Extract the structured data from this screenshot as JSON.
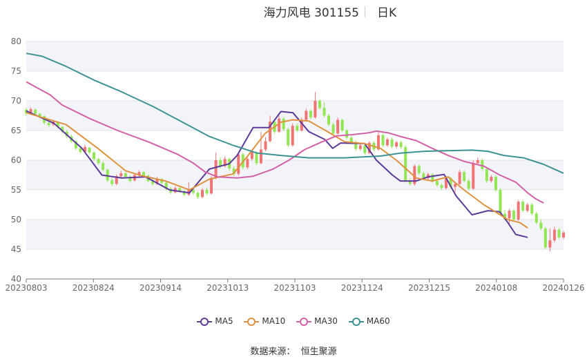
{
  "header": {
    "title": "海力风电 301155",
    "period": "日K"
  },
  "source": {
    "label": "数据来源：",
    "value": "恒生聚源"
  },
  "colors": {
    "up": "#f07474",
    "down": "#92e553",
    "ma5": "#5b3a9a",
    "ma10": "#e0913e",
    "ma30": "#d35fa6",
    "ma60": "#3c9292",
    "band": "#f3f4fa",
    "grid": "#e3e3ea"
  },
  "chart_data": {
    "type": "candlestick",
    "y_axis": {
      "min": 40,
      "max": 80,
      "ticks": [
        40,
        45,
        50,
        55,
        60,
        65,
        70,
        75,
        80
      ]
    },
    "x_axis": {
      "ticks": [
        "20230803",
        "20230824",
        "20230914",
        "20231013",
        "20231103",
        "20231124",
        "20231215",
        "20240108",
        "20240126"
      ]
    },
    "legend": [
      "MA5",
      "MA10",
      "MA30",
      "MA60"
    ],
    "grid": true,
    "candles": [
      [
        68.5,
        67.9,
        68.8,
        67.5
      ],
      [
        67.9,
        68.6,
        68.9,
        67.6
      ],
      [
        68.5,
        67.8,
        68.7,
        67.5
      ],
      [
        67.8,
        67.4,
        68.0,
        67.1
      ],
      [
        67.4,
        66.3,
        67.6,
        66.0
      ],
      [
        66.3,
        65.9,
        66.6,
        65.5
      ],
      [
        66.0,
        66.5,
        66.8,
        65.7
      ],
      [
        66.4,
        65.6,
        66.6,
        65.3
      ],
      [
        65.6,
        64.8,
        65.8,
        64.5
      ],
      [
        64.8,
        64.0,
        65.1,
        63.7
      ],
      [
        64.0,
        63.2,
        64.3,
        62.9
      ],
      [
        63.2,
        62.0,
        63.4,
        61.7
      ],
      [
        62.0,
        61.4,
        62.3,
        61.1
      ],
      [
        61.4,
        62.2,
        62.6,
        61.2
      ],
      [
        62.1,
        61.3,
        62.3,
        61.0
      ],
      [
        61.3,
        60.2,
        61.5,
        59.9
      ],
      [
        60.2,
        59.5,
        60.4,
        59.2
      ],
      [
        59.5,
        58.4,
        59.8,
        58.1
      ],
      [
        58.4,
        56.6,
        58.6,
        56.3
      ],
      [
        56.6,
        56.0,
        57.0,
        55.6
      ],
      [
        56.0,
        57.3,
        57.6,
        55.8
      ],
      [
        57.3,
        57.8,
        58.2,
        57.0
      ],
      [
        57.8,
        57.2,
        58.0,
        56.9
      ],
      [
        57.2,
        56.5,
        57.5,
        56.2
      ],
      [
        56.6,
        57.5,
        57.8,
        56.4
      ],
      [
        57.5,
        58.0,
        58.3,
        57.2
      ],
      [
        58.0,
        57.4,
        58.2,
        57.1
      ],
      [
        57.4,
        56.5,
        57.6,
        56.2
      ],
      [
        56.5,
        56.0,
        56.8,
        55.7
      ],
      [
        56.0,
        56.8,
        57.2,
        55.8
      ],
      [
        56.8,
        56.2,
        57.0,
        55.9
      ],
      [
        56.2,
        55.2,
        56.4,
        54.9
      ],
      [
        55.2,
        54.6,
        55.5,
        54.3
      ],
      [
        54.6,
        55.3,
        55.6,
        54.4
      ],
      [
        55.3,
        54.8,
        55.5,
        54.5
      ],
      [
        54.8,
        54.2,
        55.0,
        53.9
      ],
      [
        54.2,
        55.0,
        56.3,
        54.0
      ],
      [
        55.0,
        54.5,
        55.4,
        54.2
      ],
      [
        54.5,
        53.8,
        54.8,
        53.5
      ],
      [
        53.8,
        55.0,
        55.3,
        53.6
      ],
      [
        55.0,
        54.4,
        55.4,
        54.1
      ],
      [
        54.4,
        57.0,
        57.3,
        54.2
      ],
      [
        57.0,
        60.0,
        61.3,
        56.8
      ],
      [
        60.0,
        59.0,
        60.5,
        58.6
      ],
      [
        59.0,
        60.2,
        60.6,
        58.8
      ],
      [
        60.2,
        58.6,
        60.4,
        58.2
      ],
      [
        58.6,
        57.7,
        59.0,
        57.3
      ],
      [
        57.7,
        61.0,
        61.3,
        57.4
      ],
      [
        61.0,
        58.8,
        61.2,
        58.4
      ],
      [
        58.8,
        60.2,
        60.5,
        58.5
      ],
      [
        60.2,
        61.3,
        61.8,
        59.9
      ],
      [
        61.3,
        59.5,
        61.5,
        59.2
      ],
      [
        59.5,
        61.8,
        64.8,
        59.3
      ],
      [
        61.8,
        63.2,
        63.9,
        61.5
      ],
      [
        63.2,
        66.5,
        67.5,
        63.0
      ],
      [
        66.5,
        64.8,
        66.9,
        64.5
      ],
      [
        64.8,
        67.0,
        67.5,
        64.6
      ],
      [
        67.0,
        65.2,
        67.3,
        64.9
      ],
      [
        65.2,
        62.5,
        65.5,
        62.2
      ],
      [
        62.5,
        65.8,
        66.2,
        62.3
      ],
      [
        65.8,
        65.0,
        66.2,
        64.7
      ],
      [
        65.0,
        66.8,
        67.2,
        64.8
      ],
      [
        66.8,
        68.3,
        68.7,
        66.5
      ],
      [
        68.3,
        67.2,
        68.6,
        66.9
      ],
      [
        67.2,
        70.0,
        71.5,
        67.0
      ],
      [
        70.0,
        68.8,
        70.3,
        68.5
      ],
      [
        68.8,
        67.5,
        69.8,
        67.2
      ],
      [
        67.5,
        66.0,
        67.8,
        65.7
      ],
      [
        66.0,
        64.5,
        66.3,
        64.2
      ],
      [
        64.5,
        66.8,
        67.2,
        64.3
      ],
      [
        66.8,
        65.0,
        67.0,
        64.7
      ],
      [
        65.0,
        63.8,
        65.3,
        63.5
      ],
      [
        63.8,
        63.0,
        64.1,
        62.7
      ],
      [
        63.0,
        61.9,
        63.3,
        61.6
      ],
      [
        61.9,
        62.5,
        62.8,
        61.6
      ],
      [
        62.5,
        61.2,
        62.7,
        60.9
      ],
      [
        61.2,
        62.9,
        63.2,
        61.0
      ],
      [
        62.9,
        61.8,
        63.2,
        61.5
      ],
      [
        61.8,
        64.2,
        64.8,
        61.6
      ],
      [
        64.2,
        62.5,
        64.5,
        62.2
      ],
      [
        62.5,
        63.5,
        63.8,
        62.2
      ],
      [
        63.5,
        62.3,
        63.8,
        62.0
      ],
      [
        62.3,
        63.0,
        63.3,
        62.0
      ],
      [
        63.0,
        62.2,
        63.3,
        61.9
      ],
      [
        62.2,
        56.5,
        62.5,
        56.2
      ],
      [
        56.5,
        56.0,
        57.0,
        55.7
      ],
      [
        56.0,
        59.0,
        59.3,
        55.7
      ],
      [
        59.0,
        57.8,
        59.3,
        57.5
      ],
      [
        57.8,
        57.0,
        58.1,
        56.7
      ],
      [
        57.0,
        57.6,
        57.9,
        56.7
      ],
      [
        57.6,
        56.5,
        57.8,
        56.2
      ],
      [
        56.5,
        55.8,
        56.8,
        55.5
      ],
      [
        55.8,
        55.3,
        56.1,
        55.0
      ],
      [
        55.3,
        57.0,
        57.3,
        55.1
      ],
      [
        57.0,
        55.5,
        57.2,
        55.2
      ],
      [
        55.5,
        56.0,
        56.3,
        54.6
      ],
      [
        56.0,
        58.0,
        58.4,
        55.8
      ],
      [
        58.0,
        56.5,
        58.3,
        56.2
      ],
      [
        56.5,
        55.2,
        56.8,
        54.9
      ],
      [
        55.2,
        59.5,
        60.0,
        55.0
      ],
      [
        59.5,
        60.0,
        60.5,
        59.2
      ],
      [
        60.0,
        58.5,
        60.3,
        58.2
      ],
      [
        58.5,
        56.5,
        58.8,
        56.2
      ],
      [
        56.5,
        57.2,
        57.5,
        56.2
      ],
      [
        57.2,
        55.0,
        57.5,
        54.7
      ],
      [
        55.0,
        51.0,
        55.3,
        50.7
      ],
      [
        51.0,
        50.2,
        51.6,
        49.9
      ],
      [
        50.2,
        51.5,
        51.8,
        49.0
      ],
      [
        51.5,
        50.0,
        51.8,
        49.7
      ],
      [
        50.0,
        53.0,
        53.3,
        49.8
      ],
      [
        53.0,
        51.5,
        53.3,
        51.2
      ],
      [
        51.5,
        52.5,
        52.8,
        51.2
      ],
      [
        52.5,
        51.0,
        52.8,
        50.7
      ],
      [
        51.0,
        49.5,
        51.3,
        49.2
      ],
      [
        49.5,
        48.5,
        50.0,
        48.2
      ],
      [
        48.5,
        45.3,
        48.8,
        45.0
      ],
      [
        45.3,
        46.5,
        48.5,
        44.6
      ],
      [
        46.5,
        48.3,
        48.8,
        46.2
      ],
      [
        48.3,
        47.0,
        48.6,
        46.7
      ],
      [
        47.0,
        47.8,
        48.1,
        46.7
      ]
    ],
    "series": [
      {
        "name": "MA5",
        "values": [
          [
            0,
            68.3
          ],
          [
            7,
            66.2
          ],
          [
            14,
            62.0
          ],
          [
            19,
            57.5
          ],
          [
            24,
            57.0
          ],
          [
            30,
            57.2
          ],
          [
            36,
            55.0
          ],
          [
            41,
            54.5
          ],
          [
            46,
            58.5
          ],
          [
            51,
            59.4
          ],
          [
            53,
            60.8
          ],
          [
            57,
            65.5
          ],
          [
            61,
            65.5
          ],
          [
            64,
            68.2
          ],
          [
            67,
            68.0
          ],
          [
            71,
            64.8
          ],
          [
            75,
            63.5
          ],
          [
            77,
            62.0
          ],
          [
            79,
            62.9
          ],
          [
            85,
            62.8
          ],
          [
            88,
            60.0
          ],
          [
            92,
            57.5
          ],
          [
            94,
            56.5
          ],
          [
            98,
            56.5
          ],
          [
            101,
            57.2
          ],
          [
            105,
            57.6
          ],
          [
            108,
            54.0
          ],
          [
            112,
            50.8
          ],
          [
            116,
            51.5
          ],
          [
            119,
            51.3
          ],
          [
            121,
            49.5
          ],
          [
            123,
            47.5
          ],
          [
            126,
            47.0
          ]
        ]
      },
      {
        "name": "MA10",
        "values": [
          [
            0,
            68.0
          ],
          [
            10,
            66.0
          ],
          [
            18,
            62.0
          ],
          [
            25,
            58.2
          ],
          [
            29,
            57.4
          ],
          [
            35,
            56.5
          ],
          [
            41,
            55.0
          ],
          [
            46,
            56.8
          ],
          [
            52,
            57.7
          ],
          [
            56,
            61.0
          ],
          [
            60,
            64.5
          ],
          [
            64,
            66.4
          ],
          [
            67,
            66.8
          ],
          [
            71,
            66.6
          ],
          [
            76,
            64.7
          ],
          [
            80,
            63.1
          ],
          [
            85,
            62.8
          ],
          [
            89,
            62.0
          ],
          [
            93,
            60.0
          ],
          [
            98,
            57.0
          ],
          [
            102,
            56.5
          ],
          [
            106,
            57.2
          ],
          [
            110,
            55.0
          ],
          [
            115,
            52.5
          ],
          [
            121,
            50.0
          ],
          [
            124,
            49.5
          ],
          [
            126,
            48.6
          ]
        ]
      },
      {
        "name": "MA30",
        "values": [
          [
            0,
            73.2
          ],
          [
            6,
            71.0
          ],
          [
            9,
            69.3
          ],
          [
            16,
            67.0
          ],
          [
            23,
            65.0
          ],
          [
            31,
            63.0
          ],
          [
            38,
            61.0
          ],
          [
            42,
            59.5
          ],
          [
            45,
            58.0
          ],
          [
            48,
            57.2
          ],
          [
            53,
            57.0
          ],
          [
            57,
            57.3
          ],
          [
            62,
            58.5
          ],
          [
            66,
            60.0
          ],
          [
            70,
            61.8
          ],
          [
            74,
            63.0
          ],
          [
            78,
            64.1
          ],
          [
            82,
            64.3
          ],
          [
            86,
            64.6
          ],
          [
            88,
            64.9
          ],
          [
            91,
            64.6
          ],
          [
            94,
            64.0
          ],
          [
            98,
            63.3
          ],
          [
            102,
            62.0
          ],
          [
            106,
            60.8
          ],
          [
            110,
            59.8
          ],
          [
            115,
            59.0
          ],
          [
            119,
            57.5
          ],
          [
            123,
            56.3
          ],
          [
            126,
            54.5
          ],
          [
            128,
            53.5
          ],
          [
            130,
            52.8
          ]
        ]
      },
      {
        "name": "MA60",
        "values": [
          [
            0,
            78.0
          ],
          [
            4,
            77.5
          ],
          [
            10,
            75.8
          ],
          [
            17,
            73.5
          ],
          [
            24,
            71.5
          ],
          [
            32,
            69.0
          ],
          [
            39,
            66.5
          ],
          [
            46,
            64.0
          ],
          [
            52,
            62.5
          ],
          [
            58,
            61.2
          ],
          [
            64,
            60.8
          ],
          [
            71,
            60.4
          ],
          [
            80,
            60.4
          ],
          [
            89,
            60.7
          ],
          [
            94,
            61.2
          ],
          [
            100,
            61.5
          ],
          [
            106,
            61.6
          ],
          [
            112,
            61.7
          ],
          [
            116,
            61.5
          ],
          [
            120,
            60.8
          ],
          [
            125,
            60.4
          ],
          [
            130,
            59.3
          ],
          [
            135,
            57.8
          ]
        ]
      }
    ]
  }
}
